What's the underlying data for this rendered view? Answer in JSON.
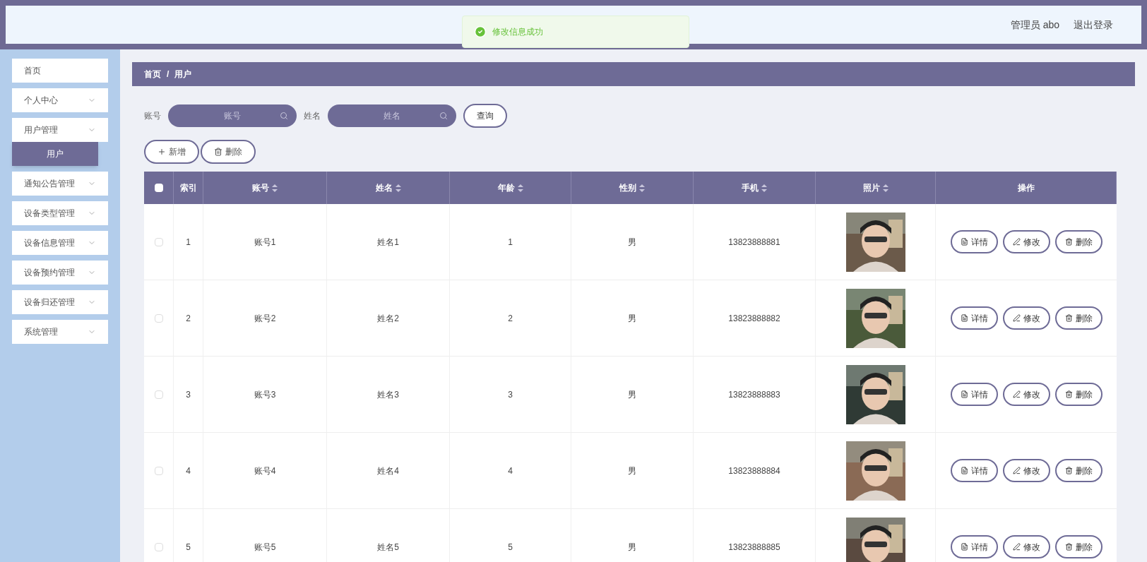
{
  "toast": {
    "text": "修改信息成功"
  },
  "header": {
    "user": "管理员 abo",
    "logout": "退出登录"
  },
  "sidebar": {
    "items": [
      {
        "label": "首页",
        "expandable": false
      },
      {
        "label": "个人中心",
        "expandable": true
      },
      {
        "label": "用户管理",
        "expandable": true,
        "children": [
          {
            "label": "用户",
            "selected": true
          }
        ]
      },
      {
        "label": "通知公告管理",
        "expandable": true
      },
      {
        "label": "设备类型管理",
        "expandable": true
      },
      {
        "label": "设备信息管理",
        "expandable": true
      },
      {
        "label": "设备预约管理",
        "expandable": true
      },
      {
        "label": "设备归还管理",
        "expandable": true
      },
      {
        "label": "系统管理",
        "expandable": true
      }
    ]
  },
  "breadcrumb": [
    "首页",
    "/",
    "用户"
  ],
  "search": {
    "fields": [
      {
        "label": "账号",
        "placeholder": "账号"
      },
      {
        "label": "姓名",
        "placeholder": "姓名"
      }
    ],
    "button": "查询"
  },
  "actions": [
    {
      "kind": "add",
      "label": "新增"
    },
    {
      "kind": "delete",
      "label": "删除"
    }
  ],
  "table": {
    "select_all": false,
    "columns": [
      {
        "label": "索引",
        "sortable": false
      },
      {
        "label": "账号",
        "sortable": true
      },
      {
        "label": "姓名",
        "sortable": true
      },
      {
        "label": "年龄",
        "sortable": true
      },
      {
        "label": "性别",
        "sortable": true
      },
      {
        "label": "手机",
        "sortable": true
      },
      {
        "label": "照片",
        "sortable": true
      },
      {
        "label": "操作",
        "sortable": false
      }
    ],
    "rows": [
      {
        "checked": false,
        "cells": [
          "1",
          "账号1",
          "姓名1",
          "1",
          "男",
          "13823888881"
        ],
        "buttons": [
          {
            "kind": "detail",
            "label": "详情"
          },
          {
            "kind": "edit",
            "label": "修改"
          },
          {
            "kind": "delete",
            "label": "删除"
          }
        ]
      },
      {
        "checked": false,
        "cells": [
          "2",
          "账号2",
          "姓名2",
          "2",
          "男",
          "13823888882"
        ],
        "buttons": [
          {
            "kind": "detail",
            "label": "详情"
          },
          {
            "kind": "edit",
            "label": "修改"
          },
          {
            "kind": "delete",
            "label": "删除"
          }
        ]
      },
      {
        "checked": false,
        "cells": [
          "3",
          "账号3",
          "姓名3",
          "3",
          "男",
          "13823888883"
        ],
        "buttons": [
          {
            "kind": "detail",
            "label": "详情"
          },
          {
            "kind": "edit",
            "label": "修改"
          },
          {
            "kind": "delete",
            "label": "删除"
          }
        ]
      },
      {
        "checked": false,
        "cells": [
          "4",
          "账号4",
          "姓名4",
          "4",
          "男",
          "13823888884"
        ],
        "buttons": [
          {
            "kind": "detail",
            "label": "详情"
          },
          {
            "kind": "edit",
            "label": "修改"
          },
          {
            "kind": "delete",
            "label": "删除"
          }
        ]
      },
      {
        "checked": false,
        "cells": [
          "5",
          "账号5",
          "姓名5",
          "5",
          "男",
          "13823888885"
        ],
        "buttons": [
          {
            "kind": "detail",
            "label": "详情"
          },
          {
            "kind": "edit",
            "label": "修改"
          },
          {
            "kind": "delete",
            "label": "删除"
          }
        ]
      }
    ]
  }
}
